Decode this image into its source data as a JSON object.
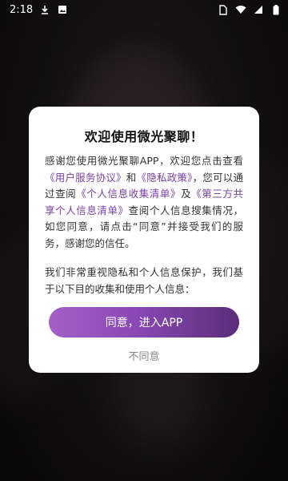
{
  "status_bar": {
    "time": "2:18",
    "icons": [
      "download-icon",
      "image-icon",
      "sim-icon",
      "wifi-icon",
      "signal-icon",
      "battery-icon"
    ]
  },
  "dialog": {
    "title": "欢迎使用微光聚聊！",
    "paragraph1": {
      "t1": "感谢您使用微光聚聊APP，欢迎您点击查看",
      "link_user_agreement": "《用户服务协议》",
      "t2": "和",
      "link_privacy_policy": "《隐私政策》",
      "t3": "，您可以通过查阅",
      "link_personal_info_list": "《个人信息收集清单》",
      "t4": "及",
      "link_third_party_list": "《第三方共享个人信息清单》",
      "t5": "查阅个人信息搜集情况，如您同意，请点击“同意”并接受我们的服务，感谢您的信任。"
    },
    "paragraph2": "我们非常重视隐私和个人信息保护，我们基于以下目的收集和使用个人信息：",
    "agree_label": "同意，进入APP",
    "disagree_label": "不同意"
  },
  "colors": {
    "link": "#7a3fa8",
    "button_gradient_start": "#a65fc8",
    "button_gradient_end": "#5b2c79"
  }
}
